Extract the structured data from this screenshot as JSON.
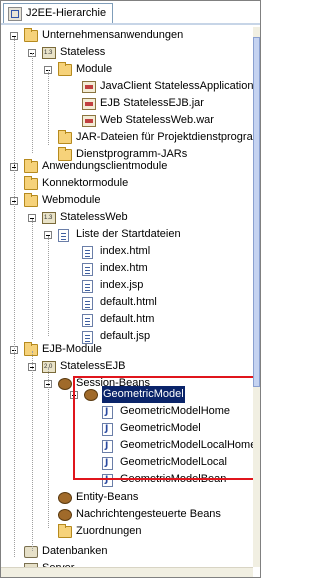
{
  "panel": {
    "title": "J2EE-Hierarchie"
  },
  "tree": [
    {
      "name": "tree-node-unternehmensanwendungen",
      "label": "Unternehmensanwendungen",
      "icon": "folder-icon",
      "exp": "minus"
    },
    {
      "name": "tree-node-stateless",
      "label": "Stateless",
      "icon": "ear-icon",
      "exp": "minus"
    },
    {
      "name": "tree-node-module",
      "label": "Module",
      "icon": "folder-icon",
      "exp": "minus"
    },
    {
      "name": "tree-node-javaclient",
      "label": "JavaClient StatelessApplicationCli",
      "icon": "jar-icon",
      "exp": ""
    },
    {
      "name": "tree-node-ejb-jar",
      "label": "EJB StatelessEJB.jar",
      "icon": "jar-icon",
      "exp": ""
    },
    {
      "name": "tree-node-web-war",
      "label": "Web StatelessWeb.war",
      "icon": "jar-icon",
      "exp": ""
    },
    {
      "name": "tree-node-jar-dateien",
      "label": "JAR-Dateien für Projektdienstprogra",
      "icon": "folder-icon",
      "exp": ""
    },
    {
      "name": "tree-node-dienstprogramm-jars",
      "label": "Dienstprogramm-JARs",
      "icon": "folder-icon",
      "exp": ""
    },
    {
      "name": "tree-node-anwendungsclientmodule",
      "label": "Anwendungsclientmodule",
      "icon": "folder-icon",
      "exp": "plus"
    },
    {
      "name": "tree-node-konnektormodule",
      "label": "Konnektormodule",
      "icon": "folder-icon",
      "exp": ""
    },
    {
      "name": "tree-node-webmodule",
      "label": "Webmodule",
      "icon": "folder-icon",
      "exp": "minus"
    },
    {
      "name": "tree-node-statelessweb",
      "label": "StatelessWeb",
      "icon": "ear-icon",
      "exp": "minus"
    },
    {
      "name": "tree-node-startdateien",
      "label": "Liste der Startdateien",
      "icon": "file-icon",
      "exp": "minus"
    },
    {
      "name": "tree-node-index-html",
      "label": "index.html",
      "icon": "file-icon",
      "exp": ""
    },
    {
      "name": "tree-node-index-htm",
      "label": "index.htm",
      "icon": "file-icon",
      "exp": ""
    },
    {
      "name": "tree-node-index-jsp",
      "label": "index.jsp",
      "icon": "file-icon",
      "exp": ""
    },
    {
      "name": "tree-node-default-html",
      "label": "default.html",
      "icon": "file-icon",
      "exp": ""
    },
    {
      "name": "tree-node-default-htm",
      "label": "default.htm",
      "icon": "file-icon",
      "exp": ""
    },
    {
      "name": "tree-node-default-jsp",
      "label": "default.jsp",
      "icon": "file-icon",
      "exp": ""
    },
    {
      "name": "tree-node-ejb-module",
      "label": "EJB-Module",
      "icon": "folder-icon",
      "exp": "minus"
    },
    {
      "name": "tree-node-statelessejb",
      "label": "StatelessEJB",
      "icon": "ear-icon",
      "exp": "minus"
    },
    {
      "name": "tree-node-session-beans",
      "label": "Session-Beans",
      "icon": "bean-icon",
      "exp": "minus"
    },
    {
      "name": "tree-node-geometricmodel",
      "label": "GeometricModel",
      "icon": "bean-icon",
      "exp": "minus",
      "selected": true
    },
    {
      "name": "tree-node-geometricmodelhome",
      "label": "GeometricModelHome",
      "icon": "java-file-icon",
      "exp": ""
    },
    {
      "name": "tree-node-geometricmodel-class",
      "label": "GeometricModel",
      "icon": "java-file-icon",
      "exp": ""
    },
    {
      "name": "tree-node-geometricmodellocalhome",
      "label": "GeometricModelLocalHome",
      "icon": "java-file-icon",
      "exp": ""
    },
    {
      "name": "tree-node-geometricmodellocal",
      "label": "GeometricModelLocal",
      "icon": "java-file-icon",
      "exp": ""
    },
    {
      "name": "tree-node-geometricmodelbean",
      "label": "GeometricModelBean",
      "icon": "java-file-icon",
      "exp": ""
    },
    {
      "name": "tree-node-entity-beans",
      "label": "Entity-Beans",
      "icon": "bean-icon",
      "exp": ""
    },
    {
      "name": "tree-node-nachrichtengesteuerte-beans",
      "label": "Nachrichtengesteuerte Beans",
      "icon": "bean-icon",
      "exp": ""
    },
    {
      "name": "tree-node-zuordnungen",
      "label": "Zuordnungen",
      "icon": "folder-icon",
      "exp": ""
    },
    {
      "name": "tree-node-datenbanken",
      "label": "Datenbanken",
      "icon": "db-icon",
      "exp": ""
    },
    {
      "name": "tree-node-server",
      "label": "Server",
      "icon": "server-icon",
      "exp": ""
    }
  ]
}
